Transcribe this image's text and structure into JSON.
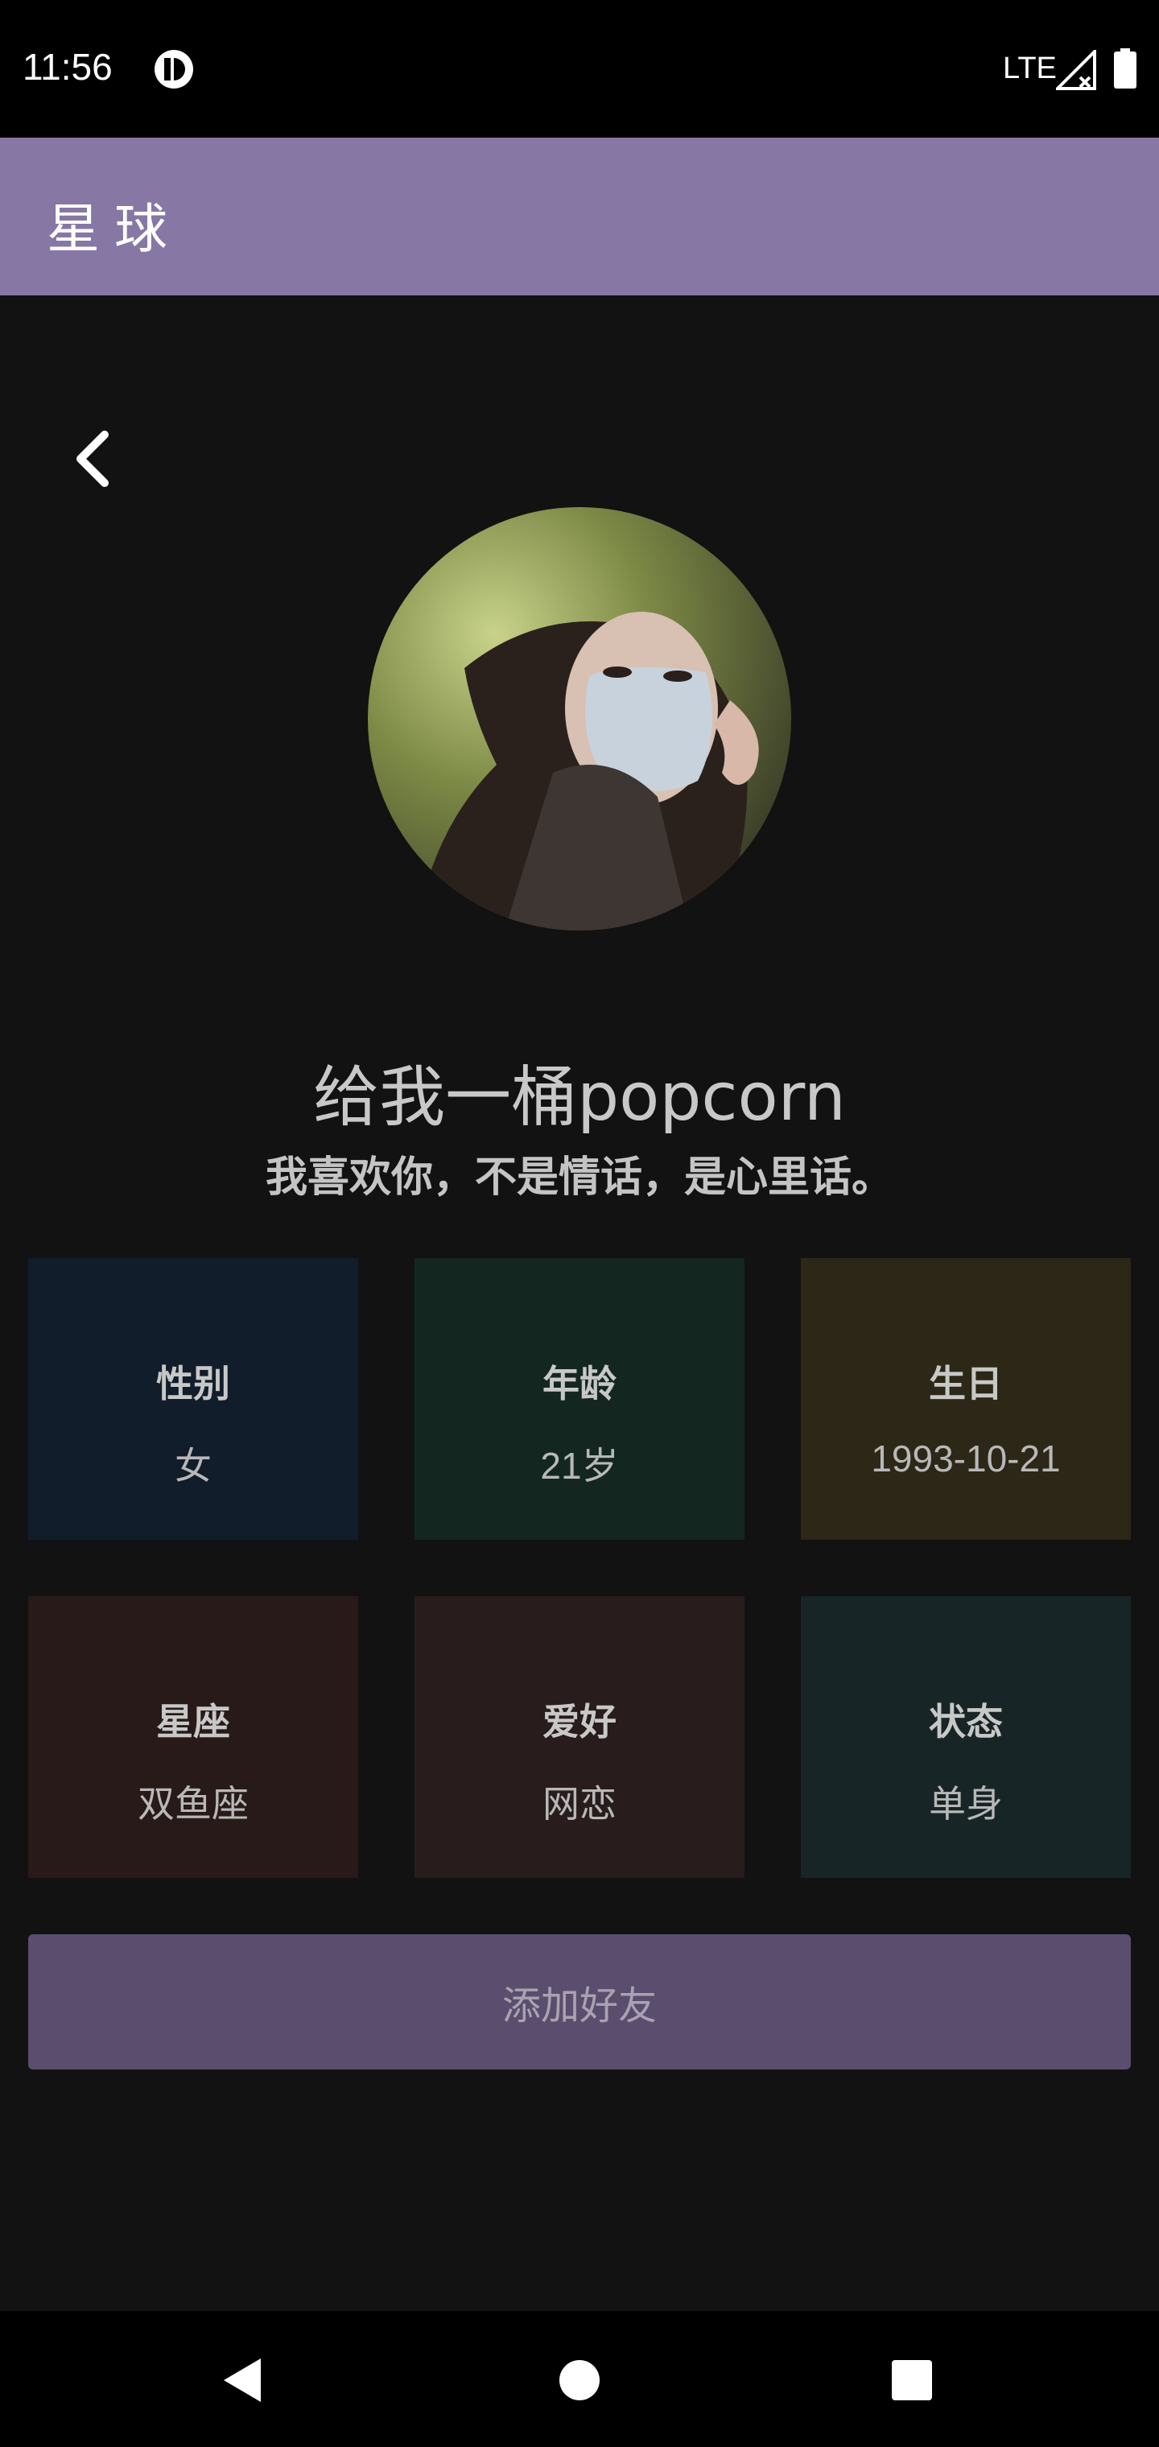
{
  "status_bar": {
    "time": "11:56",
    "network": "LTE",
    "icons": [
      "app-notification-icon",
      "signal-icon",
      "battery-icon"
    ]
  },
  "app_bar": {
    "title": "星球"
  },
  "profile": {
    "name": "给我一桶popcorn",
    "motto": "我喜欢你，不是情话，是心里话。",
    "avatar_icon": "avatar-photo"
  },
  "info_cards": [
    {
      "label": "性别",
      "value": "女",
      "color": "#121d2b"
    },
    {
      "label": "年龄",
      "value": "21岁",
      "color": "#132720"
    },
    {
      "label": "生日",
      "value": "1993-10-21",
      "color": "#2c2716"
    },
    {
      "label": "星座",
      "value": "双鱼座",
      "color": "#281a18"
    },
    {
      "label": "爱好",
      "value": "网恋",
      "color": "#281c1c"
    },
    {
      "label": "状态",
      "value": "单身",
      "color": "#182526"
    }
  ],
  "actions": {
    "add_friend_label": "添加好友"
  },
  "colors": {
    "app_bar": "#8777a4",
    "background": "#121212",
    "button": "#5a4d6e"
  }
}
